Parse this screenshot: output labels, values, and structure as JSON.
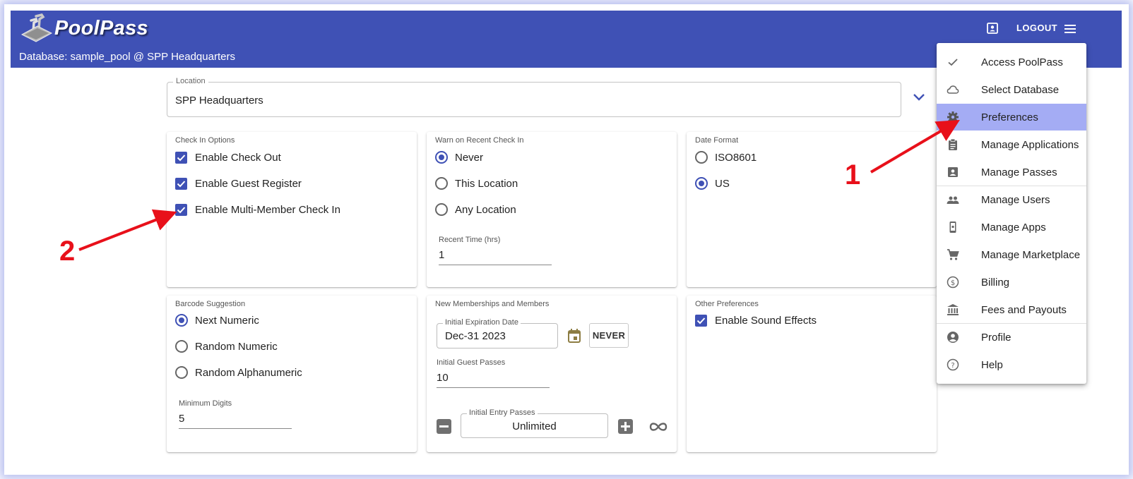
{
  "header": {
    "brand": "PoolPass",
    "database_line": "Database: sample_pool @ SPP Headquarters",
    "logout_label": "LOGOUT"
  },
  "location": {
    "label": "Location",
    "value": "SPP Headquarters"
  },
  "check_in_options": {
    "title": "Check In Options",
    "options": [
      {
        "label": "Enable Check Out",
        "checked": true
      },
      {
        "label": "Enable Guest Register",
        "checked": true
      },
      {
        "label": "Enable Multi-Member Check In",
        "checked": true
      }
    ]
  },
  "warn_recent": {
    "title": "Warn on Recent Check In",
    "options": [
      {
        "label": "Never",
        "selected": true
      },
      {
        "label": "This Location",
        "selected": false
      },
      {
        "label": "Any Location",
        "selected": false
      }
    ],
    "recent_time_label": "Recent Time (hrs)",
    "recent_time_value": "1"
  },
  "date_format": {
    "title": "Date Format",
    "options": [
      {
        "label": "ISO8601",
        "selected": false
      },
      {
        "label": "US",
        "selected": true
      }
    ]
  },
  "barcode": {
    "title": "Barcode Suggestion",
    "options": [
      {
        "label": "Next Numeric",
        "selected": true
      },
      {
        "label": "Random Numeric",
        "selected": false
      },
      {
        "label": "Random Alphanumeric",
        "selected": false
      }
    ],
    "min_digits_label": "Minimum Digits",
    "min_digits_value": "5"
  },
  "new_memberships": {
    "title": "New Memberships and Members",
    "expiration_label": "Initial Expiration Date",
    "expiration_value": "Dec-31 2023",
    "never_label": "NEVER",
    "guest_passes_label": "Initial Guest Passes",
    "guest_passes_value": "10",
    "entry_passes_label": "Initial Entry Passes",
    "entry_passes_value": "Unlimited"
  },
  "other": {
    "title": "Other Preferences",
    "options": [
      {
        "label": "Enable Sound Effects",
        "checked": true
      }
    ]
  },
  "menu": {
    "items": [
      {
        "label": "Access PoolPass",
        "icon": "check-icon"
      },
      {
        "label": "Select Database",
        "icon": "cloud-icon"
      },
      {
        "label": "Preferences",
        "icon": "gear-icon",
        "selected": true
      },
      {
        "label": "Manage Applications",
        "icon": "clipboard-icon"
      },
      {
        "label": "Manage Passes",
        "icon": "badge-icon"
      },
      {
        "label": "Manage Users",
        "icon": "people-icon"
      },
      {
        "label": "Manage Apps",
        "icon": "phone-icon"
      },
      {
        "label": "Manage Marketplace",
        "icon": "cart-icon"
      },
      {
        "label": "Billing",
        "icon": "dollar-icon"
      },
      {
        "label": "Fees and Payouts",
        "icon": "bank-icon"
      },
      {
        "label": "Profile",
        "icon": "account-icon"
      },
      {
        "label": "Help",
        "icon": "help-icon"
      }
    ]
  },
  "annotations": {
    "one": "1",
    "two": "2"
  },
  "colors": {
    "primary": "#3f51b5",
    "menu_selected": "#a4acf4",
    "annotation": "#e8101a"
  }
}
